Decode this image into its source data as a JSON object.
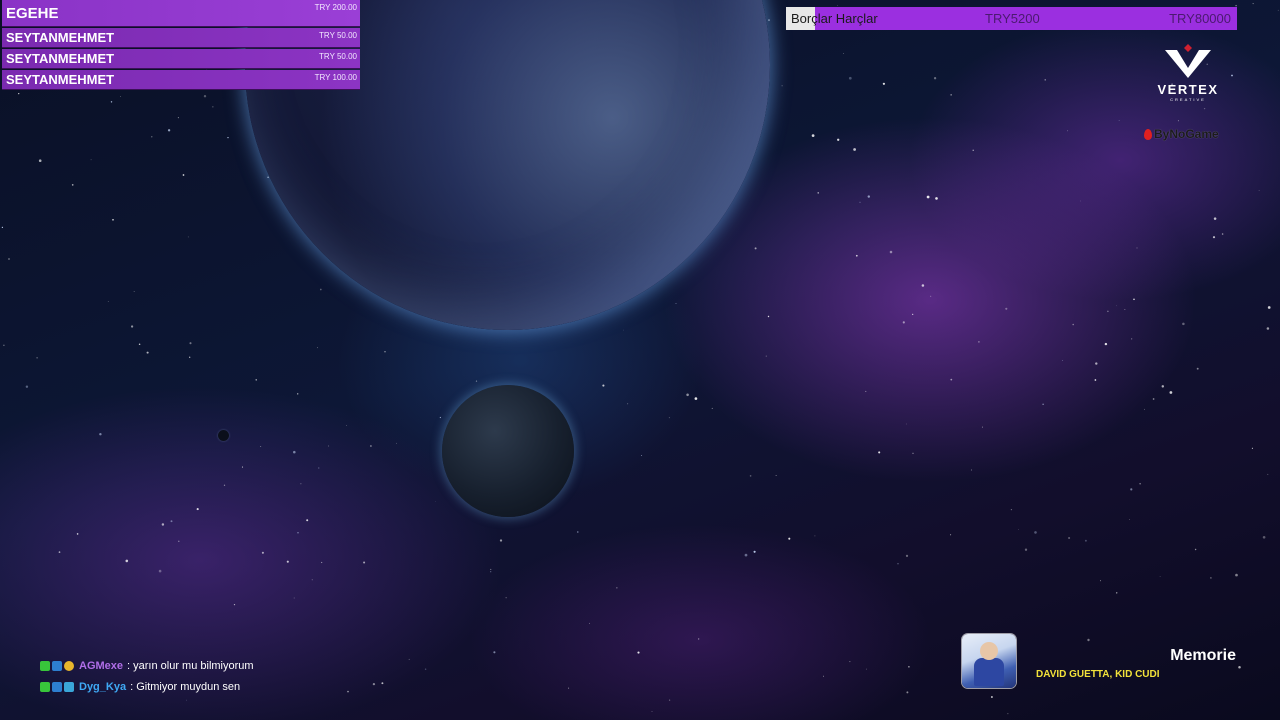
{
  "donations": [
    {
      "name": "EGEHE",
      "amount": "TRY 200.00"
    },
    {
      "name": "SEYTANMEHMET",
      "amount": "TRY 50.00"
    },
    {
      "name": "SEYTANMEHMET",
      "amount": "TRY 50.00"
    },
    {
      "name": "SEYTANMEHMET",
      "amount": "TRY 100.00"
    }
  ],
  "goal": {
    "title": "Borçlar Harçlar",
    "current": "TRY5200",
    "target": "TRY80000",
    "progress_fraction": 0.065,
    "fill_color": "#e8e8e8",
    "bar_color": "#9b2fe0"
  },
  "sponsors": {
    "vertex_name": "VERTEX",
    "vertex_sub": "CREATIVE",
    "bynogame": "ByNoGame"
  },
  "chat": [
    {
      "badges": [
        "green",
        "blue",
        "gold"
      ],
      "user": "AGMexe",
      "user_color": "#b06ee8",
      "message": ": yarın olur mu bilmiyorum"
    },
    {
      "badges": [
        "green",
        "blue",
        "cyan"
      ],
      "user": "Dyg_Kya",
      "user_color": "#3fa9f5",
      "message": ": Gitmiyor muydun sen"
    }
  ],
  "now_playing": {
    "title": "Memorie",
    "artist": "DAVID GUETTA, KID CUDI"
  },
  "colors": {
    "accent_purple": "#8c34c4",
    "artist_yellow": "#f2e23a"
  }
}
